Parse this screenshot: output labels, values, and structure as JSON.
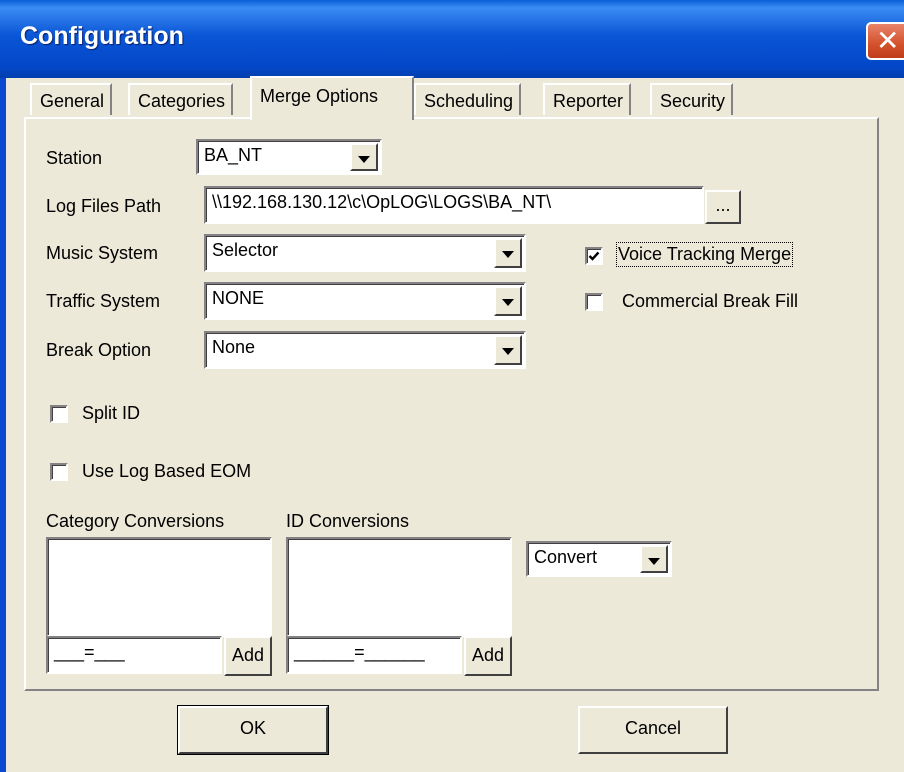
{
  "window": {
    "title": "Configuration",
    "close_glyph": "✕"
  },
  "tabs": [
    {
      "label": "General",
      "active": false
    },
    {
      "label": "Categories",
      "active": false
    },
    {
      "label": "Merge Options",
      "active": true
    },
    {
      "label": "Scheduling",
      "active": false
    },
    {
      "label": "Reporter",
      "active": false
    },
    {
      "label": "Security",
      "active": false
    }
  ],
  "form": {
    "station": {
      "label": "Station",
      "value": "BA_NT"
    },
    "log_files_path": {
      "label": "Log Files Path",
      "value": "\\\\192.168.130.12\\c\\OpLOG\\LOGS\\BA_NT\\",
      "browse_label": "..."
    },
    "music_system": {
      "label": "Music System",
      "value": "Selector"
    },
    "traffic_system": {
      "label": "Traffic System",
      "value": "NONE"
    },
    "break_option": {
      "label": "Break Option",
      "value": "None"
    },
    "voice_tracking_merge": {
      "label": "Voice Tracking Merge",
      "checked": true
    },
    "commercial_break_fill": {
      "label": "Commercial Break Fill",
      "checked": false
    },
    "split_id": {
      "label": "Split ID",
      "checked": false
    },
    "use_log_based_eom": {
      "label": "Use Log Based EOM",
      "checked": false
    }
  },
  "conversions": {
    "category": {
      "label": "Category Conversions",
      "input_value": "___=___",
      "add_label": "Add"
    },
    "id": {
      "label": "ID Conversions",
      "input_value": "______=______",
      "add_label": "Add"
    },
    "mode": {
      "value": "Convert"
    }
  },
  "buttons": {
    "ok": "OK",
    "cancel": "Cancel"
  }
}
